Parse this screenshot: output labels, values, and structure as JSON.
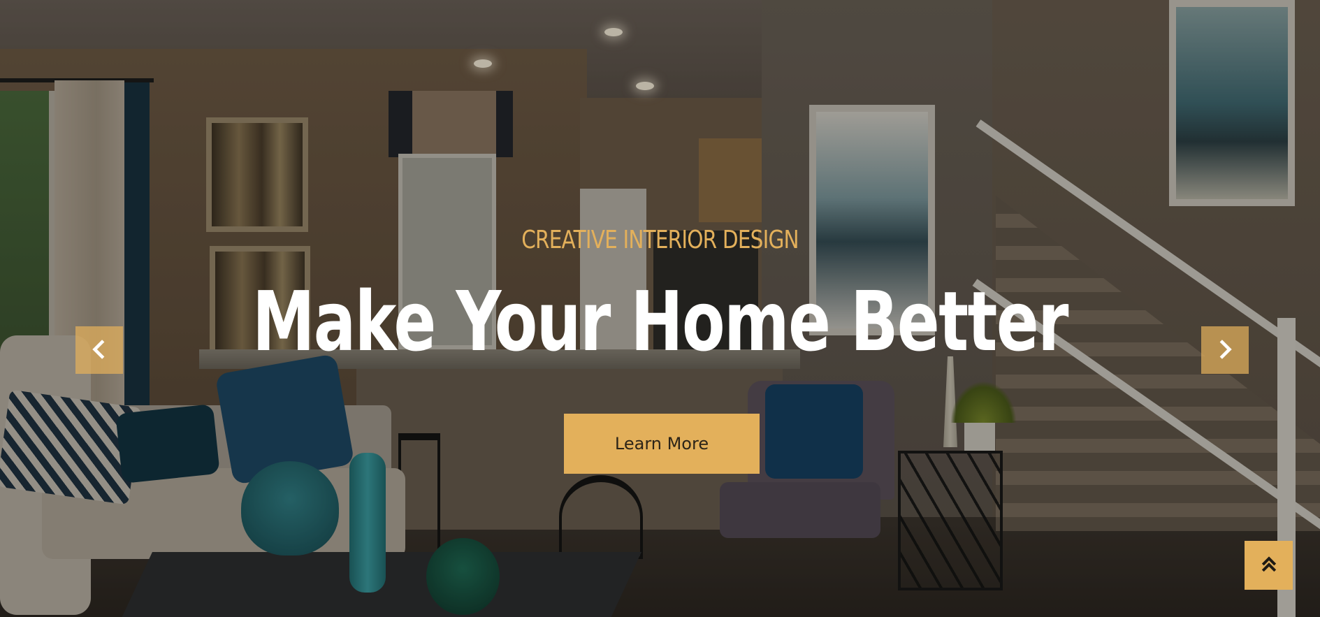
{
  "hero": {
    "subtitle": "CREATIVE INTERIOR DESIGN",
    "title": "Make Your Home Better",
    "cta_label": "Learn More"
  },
  "carousel": {
    "prev_icon": "chevron-left-icon",
    "next_icon": "chevron-right-icon"
  },
  "back_to_top": {
    "icon": "double-chevron-up-icon"
  },
  "colors": {
    "accent": "#e3b05b",
    "title": "#ffffff",
    "cta_text": "#2c2418"
  }
}
